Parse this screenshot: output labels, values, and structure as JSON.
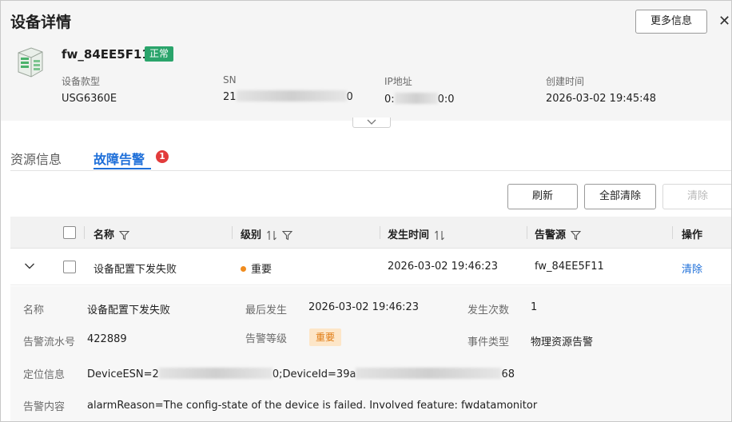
{
  "dialog": {
    "title": "设备详情",
    "more_info_label": "更多信息",
    "close_glyph": "✕"
  },
  "device": {
    "name": "fw_84EE5F11",
    "status": "正常",
    "model_label": "设备款型",
    "model_value": "USG6360E",
    "sn_label": "SN",
    "sn_prefix": "21",
    "sn_suffix": "0",
    "ip_label": "IP地址",
    "ip_prefix": "0:",
    "ip_suffix": "0:0",
    "created_label": "创建时间",
    "created_value": "2026-03-02 19:45:48"
  },
  "tabs": {
    "resource": "资源信息",
    "alarm": "故障告警",
    "alarm_count": "1"
  },
  "toolbar": {
    "refresh": "刷新",
    "clear_all": "全部清除",
    "clear": "清除"
  },
  "table": {
    "headers": {
      "name": "名称",
      "level": "级别",
      "time": "发生时间",
      "source": "告警源",
      "action": "操作"
    },
    "row": {
      "name": "设备配置下发失败",
      "level": "重要",
      "time": "2026-03-02 19:46:23",
      "source": "fw_84EE5F11",
      "action": "清除"
    }
  },
  "detail": {
    "name_label": "名称",
    "name_value": "设备配置下发失败",
    "last_label": "最后发生",
    "last_value": "2026-03-02 19:46:23",
    "count_label": "发生次数",
    "count_value": "1",
    "serial_label": "告警流水号",
    "serial_value": "422889",
    "level_label": "告警等级",
    "level_value": "重要",
    "event_label": "事件类型",
    "event_value": "物理资源告警",
    "location_label": "定位信息",
    "location_part1": "DeviceESN=2",
    "location_part2": "0;DeviceId=39a",
    "location_part3": "68",
    "content_label": "告警内容",
    "content_value": "alarmReason=The config-state of the device is failed. Involved feature: fwdatamonitor"
  },
  "colors": {
    "accent": "#1e6fd9",
    "status_green": "#2aa46b",
    "severity_orange": "#f08c1e",
    "badge_red": "#e23b3b"
  }
}
